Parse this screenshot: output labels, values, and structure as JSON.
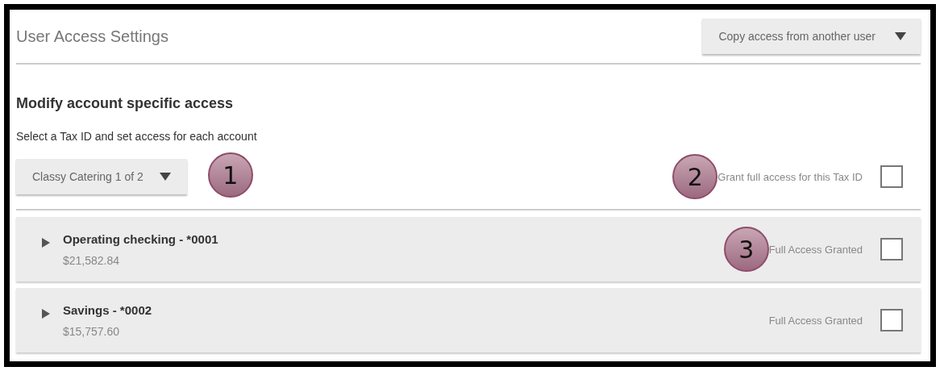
{
  "header": {
    "title": "User Access Settings",
    "copy_button": "Copy access from another user"
  },
  "section": {
    "heading": "Modify account specific access",
    "subtitle": "Select a Tax ID and set access for each account"
  },
  "tax_id": {
    "dropdown": "Classy Catering 1 of 2",
    "callout": "1",
    "grant_label": "Grant full access for this Tax ID",
    "grant_callout": "2",
    "checked": false
  },
  "accounts": [
    {
      "name": "Operating checking - *0001",
      "balance": "$21,582.84",
      "label": "Full Access Granted",
      "checked": false,
      "expanded": false,
      "callout": "3"
    },
    {
      "name": "Savings - *0002",
      "balance": "$15,757.60",
      "label": "Full Access Granted",
      "checked": false,
      "expanded": false
    }
  ]
}
